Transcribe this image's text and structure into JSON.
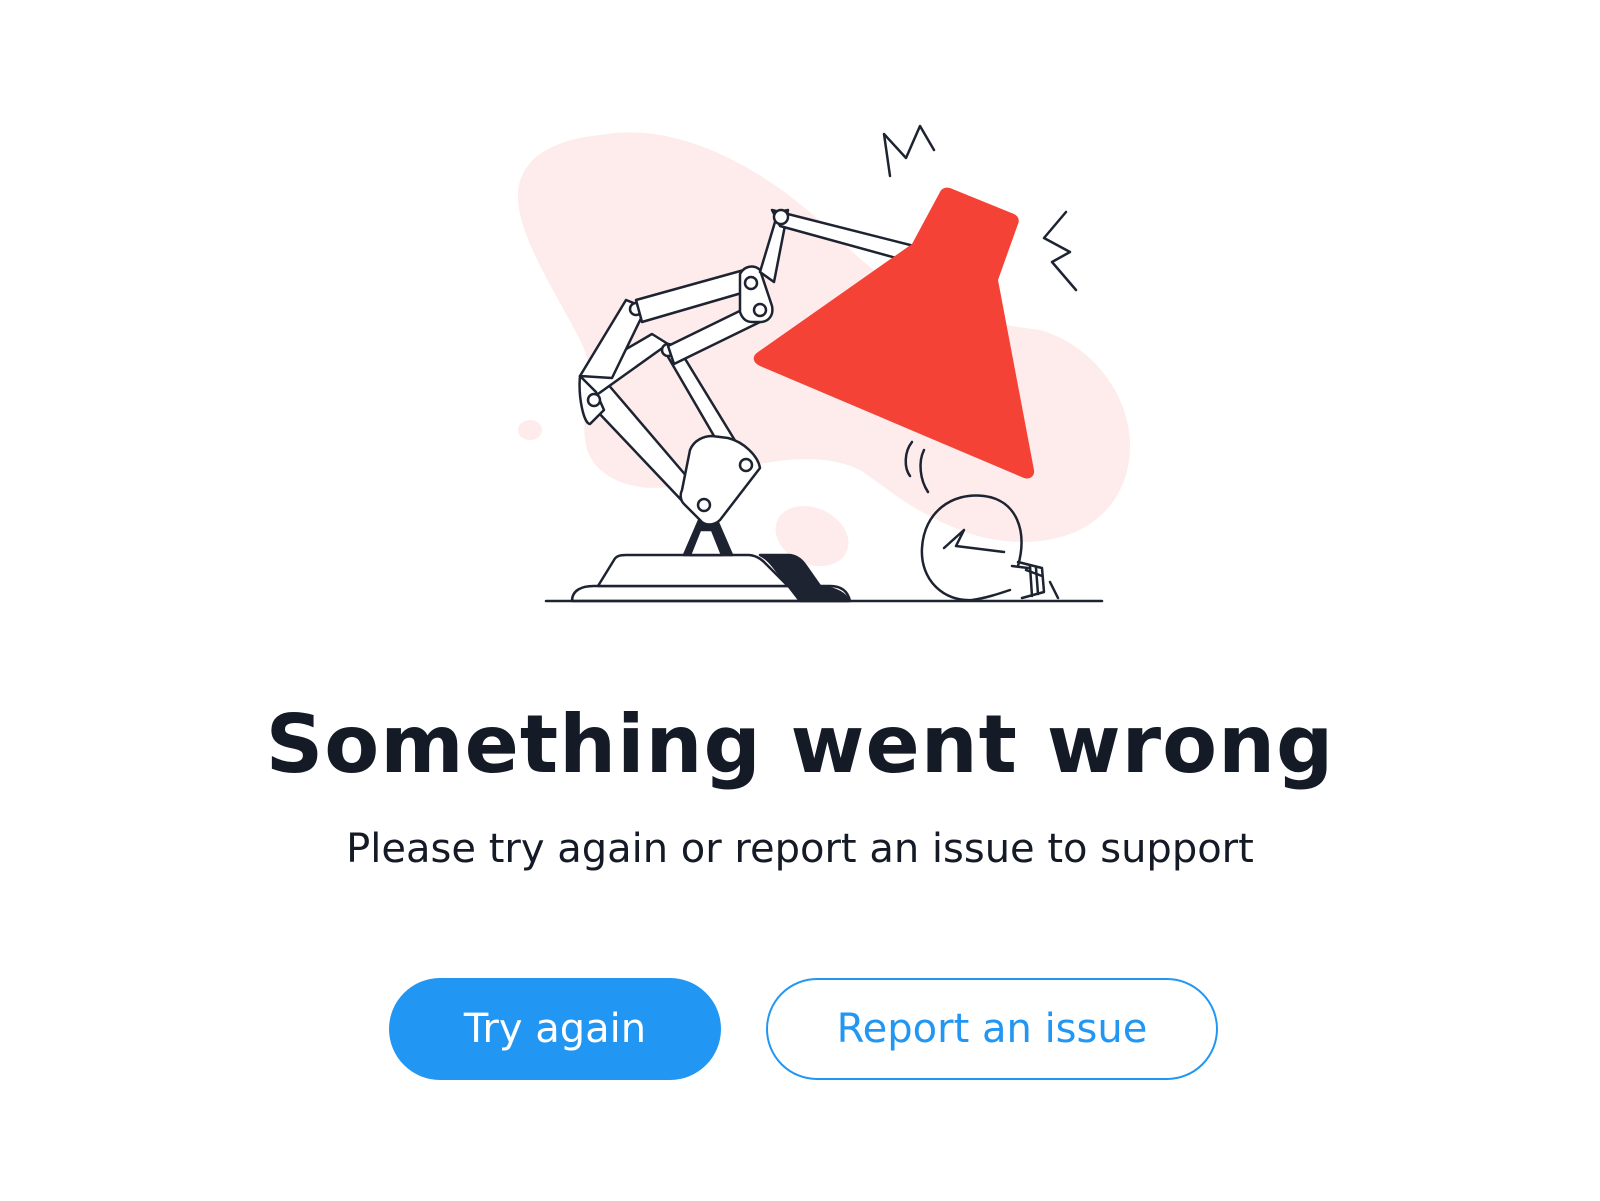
{
  "error_page": {
    "title": "Something went wrong",
    "message": "Please try again or report an issue to support",
    "primary_button_label": "Try again",
    "secondary_button_label": "Report an issue"
  },
  "illustration": {
    "subject": "broken-desk-lamp",
    "icons": [
      "desk-lamp-icon",
      "broken-lightbulb-icon"
    ]
  },
  "colors": {
    "accent_blue": "#2196f3",
    "lamp_red": "#f44336",
    "blob_pink": "#fdeceb",
    "text_dark": "#151b26",
    "line_dark": "#1d2330",
    "background": "#ffffff"
  }
}
